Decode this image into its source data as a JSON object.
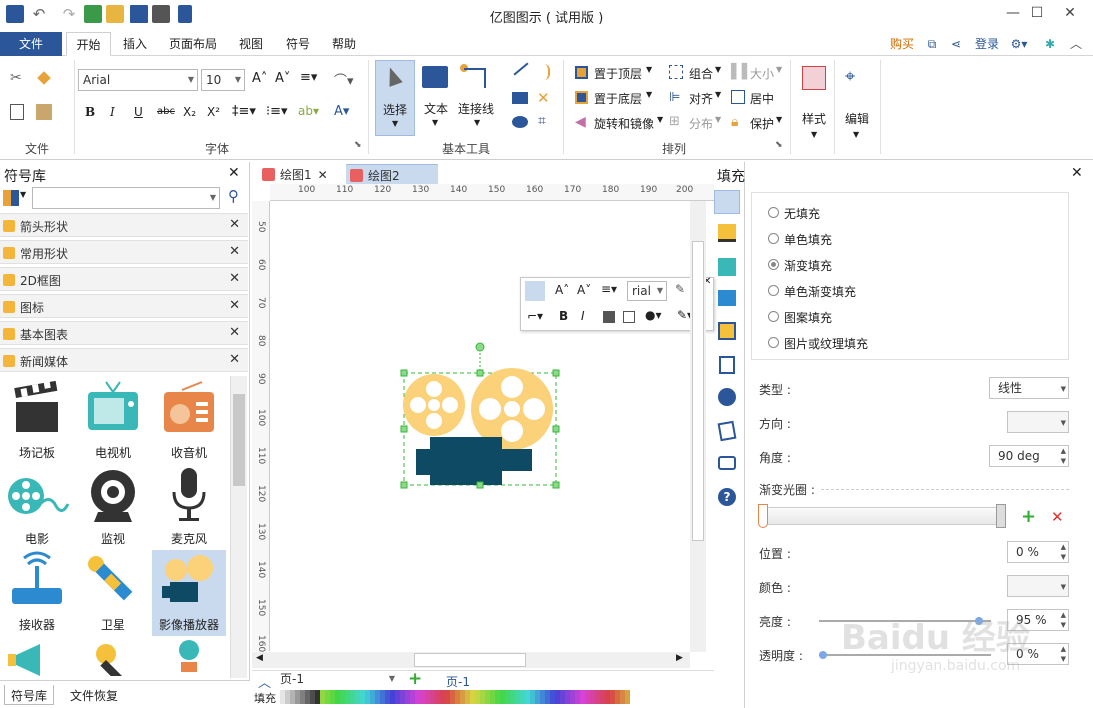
{
  "window": {
    "title": "亿图图示 ( 试用版 )"
  },
  "ribbon_tabs": {
    "file": "文件",
    "tabs": [
      "开始",
      "插入",
      "页面布局",
      "视图",
      "符号",
      "帮助"
    ],
    "right": {
      "buy": "购买",
      "login": "登录"
    }
  },
  "ribbon": {
    "file_group": {
      "label": "文件"
    },
    "font_group": {
      "label": "字体",
      "font": "Arial",
      "size": "10"
    },
    "tools_group": {
      "label": "基本工具",
      "select": "选择",
      "text": "文本",
      "connector": "连接线"
    },
    "arrange_group": {
      "label": "排列",
      "bring_front": "置于顶层",
      "send_back": "置于底层",
      "rotate": "旋转和镜像",
      "group": "组合",
      "align": "对齐",
      "distribute": "分布",
      "size": "大小",
      "center": "居中",
      "protect": "保护"
    },
    "style": "样式",
    "edit": "编辑"
  },
  "library": {
    "title": "符号库",
    "search_placeholder": "",
    "rows": [
      "箭头形状",
      "常用形状",
      "2D框图",
      "图标",
      "基本图表",
      "新闻媒体"
    ],
    "symbols": [
      "场记板",
      "电视机",
      "收音机",
      "电影",
      "监视",
      "麦克风",
      "接收器",
      "卫星",
      "影像播放器"
    ],
    "bottom_tabs": [
      "符号库",
      "文件恢复"
    ]
  },
  "documents": {
    "tabs": [
      "绘图1",
      "绘图2"
    ],
    "page": "页-1",
    "page_tab": "页-1",
    "fill_label": "填充"
  },
  "ruler": {
    "h": [
      "100",
      "110",
      "120",
      "130",
      "140",
      "150",
      "160",
      "170",
      "180",
      "190",
      "200"
    ],
    "v": [
      "50",
      "60",
      "70",
      "80",
      "90",
      "100",
      "110",
      "120",
      "130",
      "140",
      "150",
      "160"
    ]
  },
  "floating_toolbar": {
    "font": "rial"
  },
  "fill_panel": {
    "title": "填充",
    "options": [
      "无填充",
      "单色填充",
      "渐变填充",
      "单色渐变填充",
      "图案填充",
      "图片或纹理填充"
    ],
    "selected": "渐变填充",
    "type_label": "类型 :",
    "type_value": "线性",
    "direction_label": "方向 :",
    "direction_value": "",
    "angle_label": "角度 :",
    "angle_value": "90 deg",
    "aperture_label": "渐变光圈 :",
    "position_label": "位置 :",
    "position_value": "0 %",
    "color_label": "颜色 :",
    "color_value": "",
    "brightness_label": "亮度 :",
    "brightness_value": "95 %",
    "brightness_level": 0.95,
    "opacity_label": "透明度 :",
    "opacity_value": "0 %",
    "opacity_level": 0.0
  },
  "watermark": {
    "text": "Baidu 经验",
    "url": "jingyan.baidu.com"
  },
  "colors": {
    "accent": "#2b579a",
    "reel": "#fbd179",
    "camera": "#0e4a63",
    "selection": "#33bb33"
  }
}
